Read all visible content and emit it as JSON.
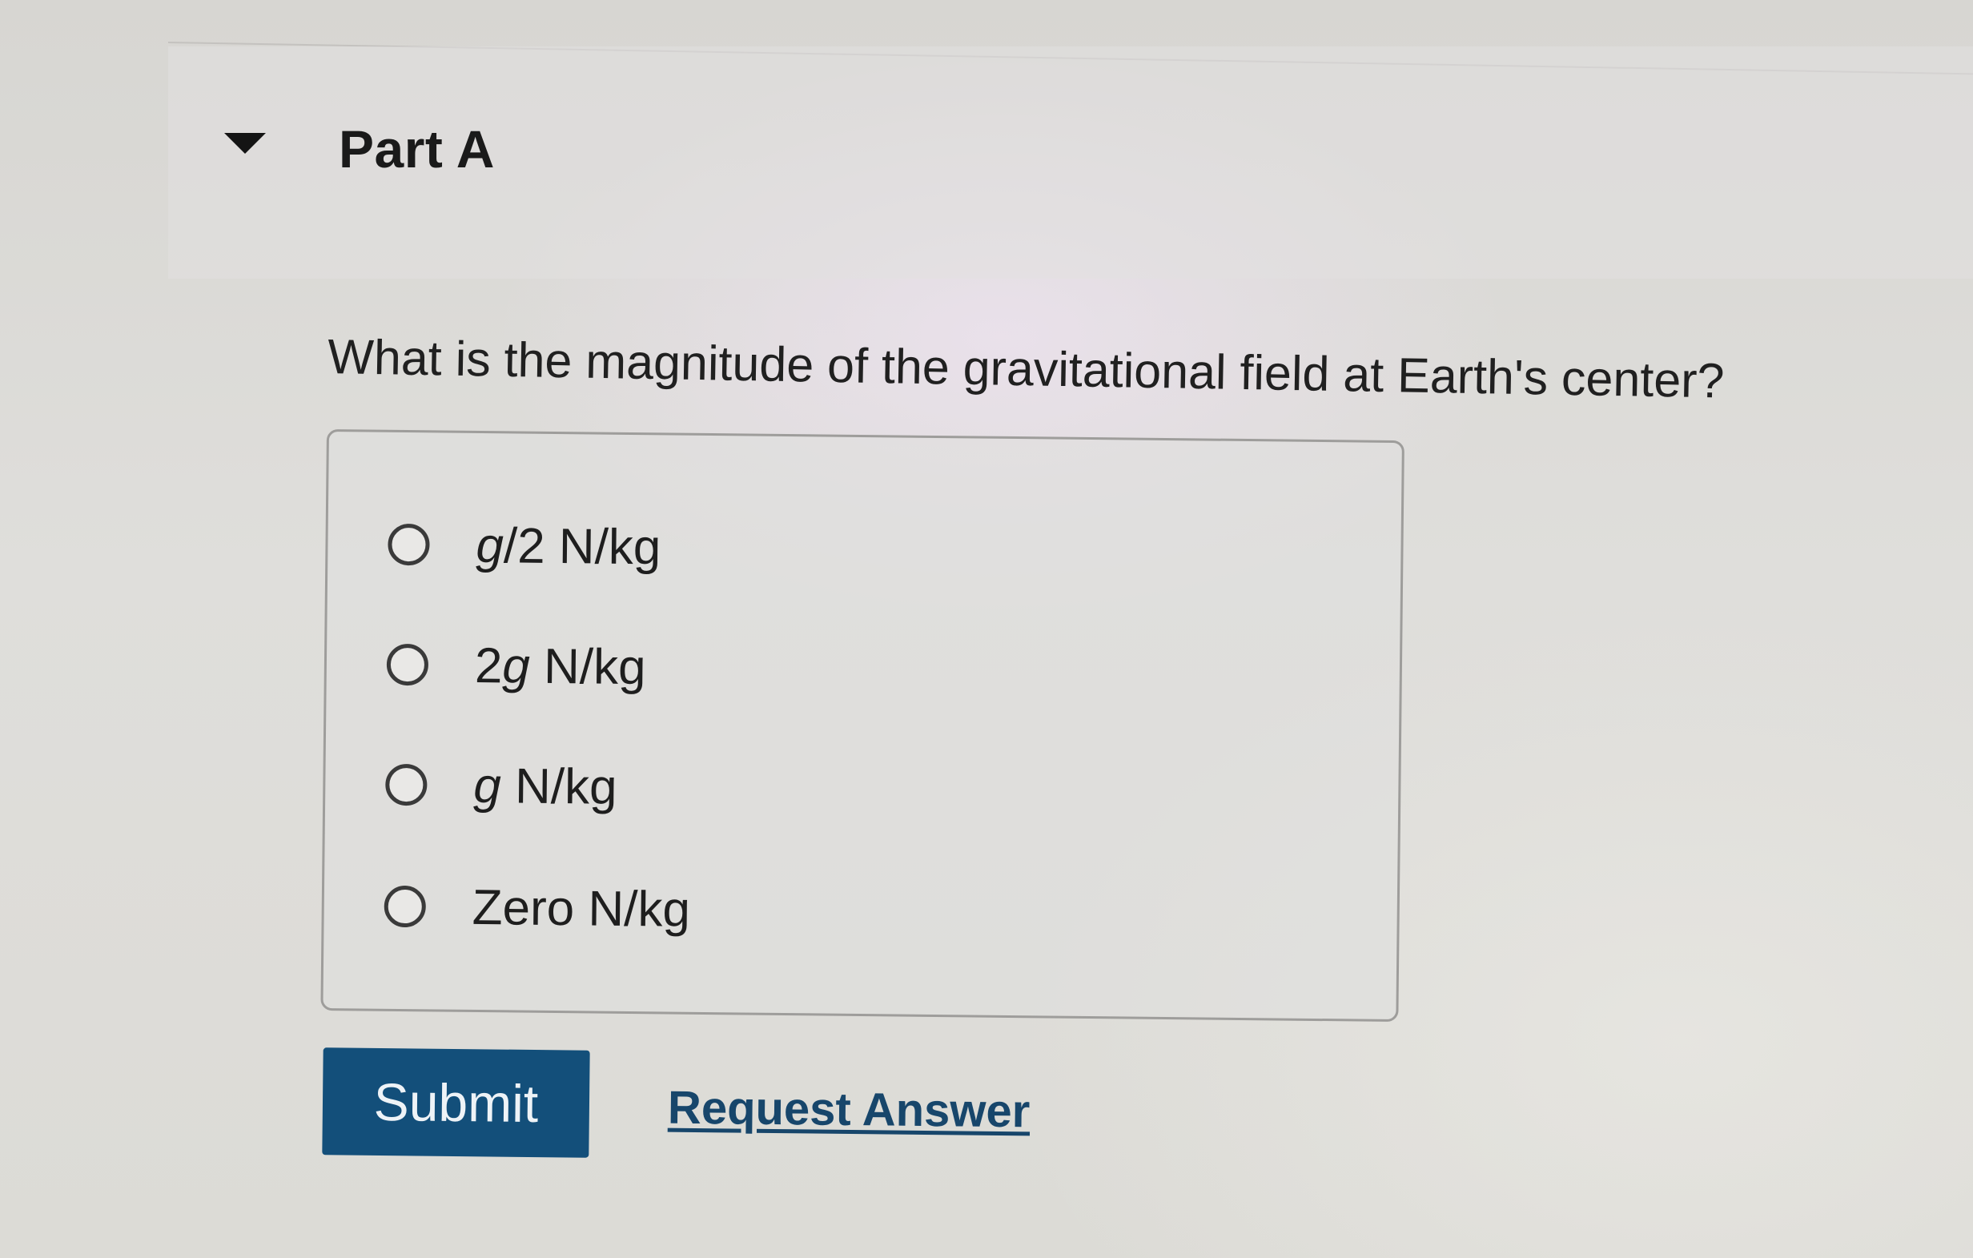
{
  "part": {
    "title": "Part A",
    "toggle_icon": "caret-down-icon"
  },
  "question": {
    "text": "What is the magnitude of the gravitational field at Earth's center?"
  },
  "options": [
    {
      "prefix": "",
      "var": "g",
      "suffix": "/2 N/kg"
    },
    {
      "prefix": "2",
      "var": "g",
      "suffix": " N/kg"
    },
    {
      "prefix": "",
      "var": "g",
      "suffix": " N/kg"
    },
    {
      "prefix": "Zero N/kg",
      "var": "",
      "suffix": ""
    }
  ],
  "actions": {
    "submit_label": "Submit",
    "request_answer_label": "Request Answer"
  },
  "colors": {
    "submit_bg": "#134f7a",
    "link": "#17466b"
  }
}
